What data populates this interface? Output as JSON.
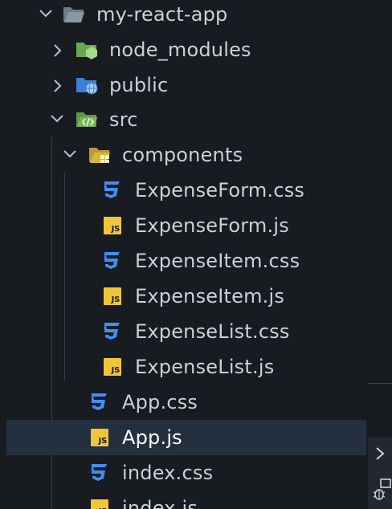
{
  "tree": {
    "root": {
      "label": "my-react-app"
    },
    "node_modules": {
      "label": "node_modules"
    },
    "public": {
      "label": "public"
    },
    "src": {
      "label": "src"
    },
    "components": {
      "label": "components"
    },
    "files": [
      {
        "label": "ExpenseForm.css",
        "type": "css"
      },
      {
        "label": "ExpenseForm.js",
        "type": "js"
      },
      {
        "label": "ExpenseItem.css",
        "type": "css"
      },
      {
        "label": "ExpenseItem.js",
        "type": "js"
      },
      {
        "label": "ExpenseList.css",
        "type": "css"
      },
      {
        "label": "ExpenseList.js",
        "type": "js"
      }
    ],
    "src_files": [
      {
        "label": "App.css",
        "type": "css"
      },
      {
        "label": "App.js",
        "type": "js",
        "selected": true
      },
      {
        "label": "index.css",
        "type": "css"
      },
      {
        "label": "index.js",
        "type": "js"
      }
    ],
    "js_badge_text": "JS"
  },
  "colors": {
    "background": "#181b20",
    "selected_row": "#243040",
    "text": "#c9d1dc",
    "css_icon": "#3f8ff7",
    "js_icon": "#f0c53a",
    "folder_grey": "#8a95a5",
    "folder_green": "#7cb65a",
    "folder_blue": "#4e8fe0"
  }
}
